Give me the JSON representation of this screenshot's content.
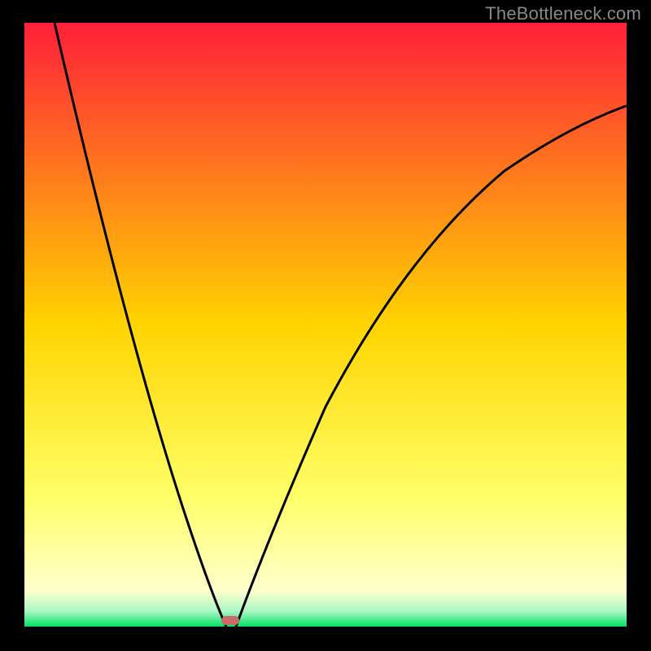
{
  "watermark": "TheBottleneck.com",
  "chart_data": {
    "type": "line",
    "title": "",
    "xlabel": "",
    "ylabel": "",
    "xlim": [
      0,
      100
    ],
    "ylim": [
      0,
      100
    ],
    "background_gradient": {
      "stops": [
        {
          "offset": 0.0,
          "color": "#ff1f3a"
        },
        {
          "offset": 0.5,
          "color": "#ffd400"
        },
        {
          "offset": 0.78,
          "color": "#ffff66"
        },
        {
          "offset": 0.94,
          "color": "#ffffcc"
        },
        {
          "offset": 0.975,
          "color": "#a9f7c5"
        },
        {
          "offset": 1.0,
          "color": "#00e060"
        }
      ]
    },
    "optimal_x": 33,
    "marker": {
      "x": 33,
      "y": 1.5,
      "color": "#c96b66"
    },
    "curves": {
      "left": {
        "description": "steep descending lobe left of minimum",
        "x": [
          5,
          10,
          15,
          20,
          25,
          30,
          33
        ],
        "y": [
          100,
          80,
          60,
          42,
          24,
          8,
          0
        ]
      },
      "right": {
        "description": "rising lobe right of minimum, sublinear",
        "x": [
          33,
          40,
          50,
          60,
          70,
          80,
          90,
          100
        ],
        "y": [
          0,
          18,
          36,
          48,
          57,
          64,
          69,
          73
        ]
      }
    }
  }
}
